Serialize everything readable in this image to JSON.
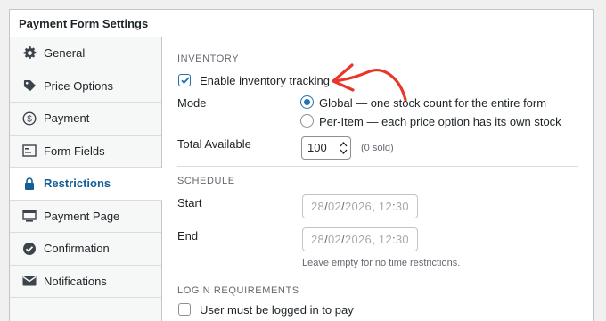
{
  "panel": {
    "title": "Payment Form Settings"
  },
  "sidebar": {
    "items": [
      {
        "label": "General",
        "icon": "gear-icon"
      },
      {
        "label": "Price Options",
        "icon": "tag-icon"
      },
      {
        "label": "Payment",
        "icon": "dollar-circle-icon"
      },
      {
        "label": "Form Fields",
        "icon": "form-fields-icon"
      },
      {
        "label": "Restrictions",
        "icon": "lock-icon",
        "active": true
      },
      {
        "label": "Payment Page",
        "icon": "payment-page-icon"
      },
      {
        "label": "Confirmation",
        "icon": "check-circle-icon"
      },
      {
        "label": "Notifications",
        "icon": "envelope-icon"
      }
    ]
  },
  "inventory": {
    "heading": "INVENTORY",
    "enable_label": "Enable inventory tracking",
    "enable_checked": true,
    "mode_label": "Mode",
    "mode_options": [
      {
        "label": "Global — one stock count for the entire form",
        "selected": true
      },
      {
        "label": "Per-Item — each price option has its own stock",
        "selected": false
      }
    ],
    "total_label": "Total Available",
    "total_value": "100",
    "sold_text": "(0 sold)"
  },
  "schedule": {
    "heading": "SCHEDULE",
    "start_label": "Start",
    "start_day": "28",
    "start_month": "02",
    "start_year": "2026",
    "start_hour": "12",
    "start_minute": "30",
    "end_label": "End",
    "end_day": "28",
    "end_month": "02",
    "end_year": "2026",
    "end_hour": "12",
    "end_minute": "30",
    "hint": "Leave empty for no time restrictions."
  },
  "login": {
    "heading": "LOGIN REQUIREMENTS",
    "require_label": "User must be logged in to pay",
    "require_checked": false
  },
  "colors": {
    "accent": "#2271b1",
    "annotation": "#e8372a"
  }
}
